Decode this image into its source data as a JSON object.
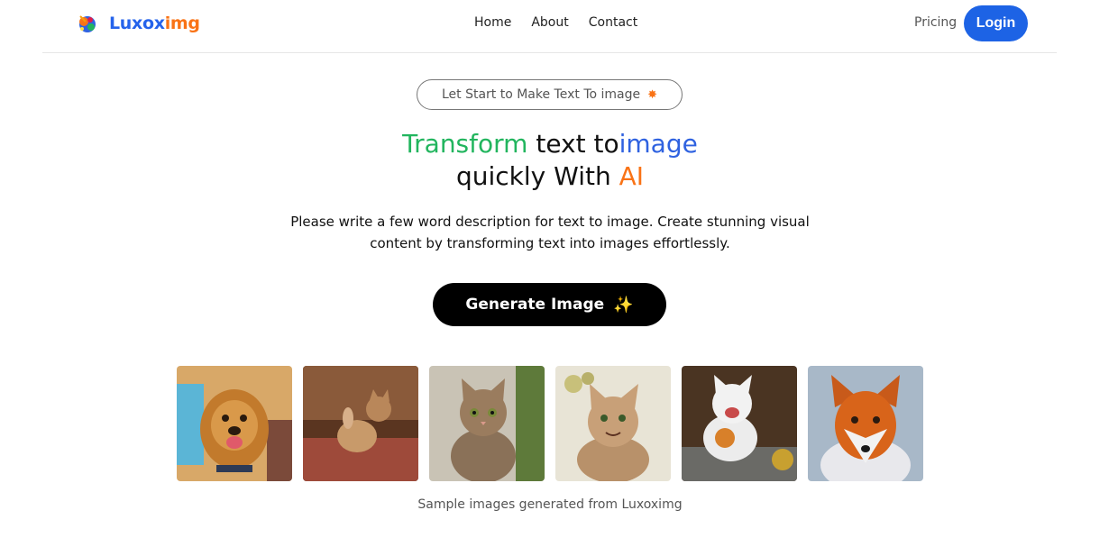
{
  "brand": {
    "name_part1": "Luxox",
    "name_part2": "img",
    "logo_icon": "paint-splash-logo-icon"
  },
  "nav": {
    "home": "Home",
    "about": "About",
    "contact": "Contact"
  },
  "header_actions": {
    "pricing": "Pricing",
    "login": "Login"
  },
  "hero": {
    "pill_text": "Let Start to Make Text To image",
    "pill_icon": "sparkle-burst-icon",
    "headline_1": "Transform",
    "headline_2": " text to",
    "headline_3": "image",
    "headline_4": "quickly With ",
    "headline_5": "AI",
    "description_line1": "Please write a few word description for text to image. Create stunning visual",
    "description_line2": "content by transforming text into images effortlessly.",
    "button_label": "Generate Image",
    "button_icon": "sparkles-icon"
  },
  "gallery": {
    "images": [
      "golden-retriever-image",
      "kitten-playing-image",
      "tabby-cat-image",
      "smiling-cat-image",
      "white-kitten-apple-image",
      "red-fox-image"
    ],
    "caption": "Sample images generated from Luxoximg"
  },
  "colors": {
    "primary_blue": "#1d63e5",
    "accent_green": "#22b55e",
    "accent_orange": "#f97316",
    "button_dark": "#000000"
  }
}
